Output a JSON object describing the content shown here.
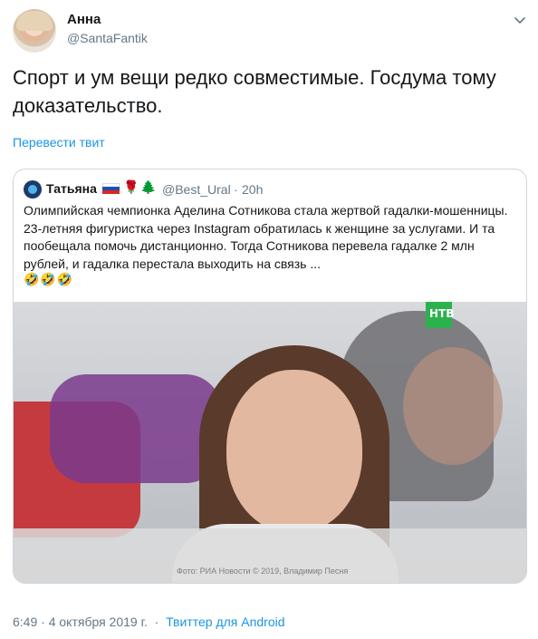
{
  "author": {
    "name": "Анна",
    "handle": "@SantaFantik"
  },
  "tweet_text": "Спорт и ум вещи редко совместимые. Госдума тому доказательство.",
  "translate_label": "Перевести твит",
  "quote": {
    "name": "Татьяна",
    "handle": "@Best_Ural",
    "separator": "·",
    "time": "20h",
    "text": "Олимпийская чемпионка Аделина Сотникова стала жертвой гадалки-мошенницы. 23-летняя фигуристка через Instagram обратилась к женщине за услугами. И та пообещала помочь дистанционно. Тогда Сотникова перевела гадалке 2 млн рублей, и гадалка перестала выходить на связь ...",
    "emoji": "🤣🤣🤣",
    "rose": "🌹",
    "tree": "🌲",
    "image_badge": "НТВ",
    "image_caption": "Фото: РИА Новости © 2019, Владимир Песня"
  },
  "meta": {
    "time": "6:49",
    "dot1": "·",
    "date": "4 октября 2019 г.",
    "dot2": "·",
    "source": "Твиттер для Android"
  },
  "colors": {
    "accent": "#1b95e0",
    "muted": "#657786",
    "border": "#ccd6dd"
  },
  "icons": [
    "avatar-image",
    "chevron-down-icon",
    "russia-flag-icon",
    "rose-icon",
    "tree-icon",
    "ntv-logo-icon"
  ]
}
